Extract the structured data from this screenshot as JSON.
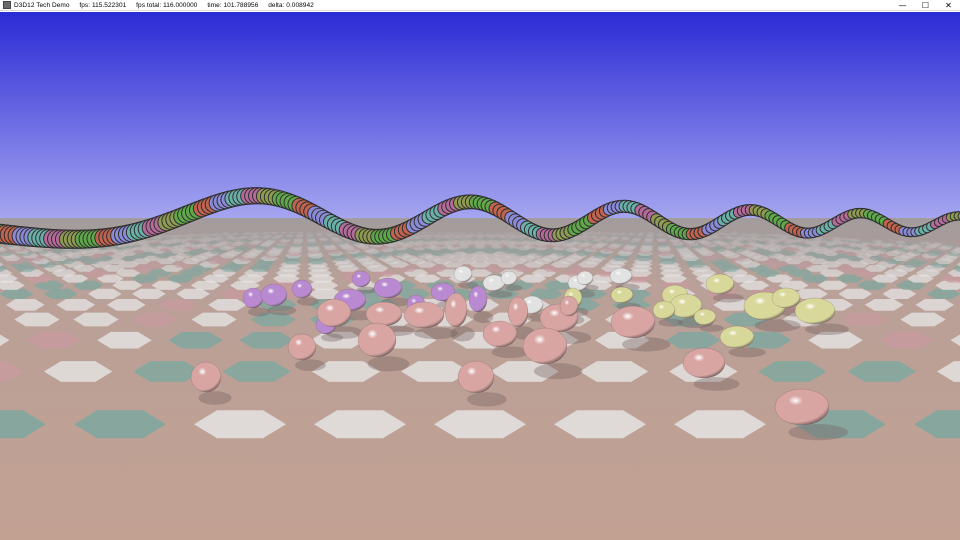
{
  "window": {
    "title": "D3D12 Tech Demo",
    "fps": "fps: 115.522301",
    "fps_total": "fps total: 116.000000",
    "time": "time: 101.788956",
    "delta": "delta: 0.008942",
    "controls": {
      "minimize": "—",
      "maximize": "☐",
      "close": "✕"
    }
  },
  "scene": {
    "sky_top": "#2b2bd6",
    "sky_horizon": "#a6a6f0",
    "ground_color": "#c2a193",
    "hex_white": "#e7e7e7",
    "hex_teal": "#7aa8a0",
    "hex_pink": "#c99aa0",
    "sphere_colors": {
      "pink": "#d8a5a3",
      "purple": "#b98ad1",
      "yellow": "#d8d89a",
      "white": "#e2e2e2"
    },
    "tube_colors": [
      "#5fa84a",
      "#c0634f",
      "#8a8ad8",
      "#6bb0a8",
      "#b56b9a",
      "#8f9a52"
    ]
  }
}
